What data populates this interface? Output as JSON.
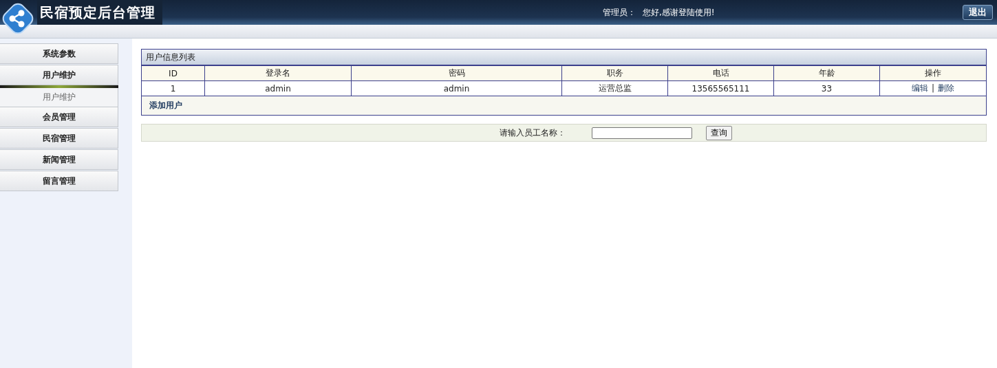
{
  "header": {
    "title": "民宿预定后台管理",
    "greeting_label": "管理员：",
    "greeting": "您好,感谢登陆使用!",
    "logout": "退出"
  },
  "sidebar": {
    "items": [
      {
        "label": "系统参数",
        "expanded": false
      },
      {
        "label": "用户维护",
        "expanded": true,
        "children": [
          {
            "label": "用户维护"
          }
        ]
      },
      {
        "label": "会员管理",
        "expanded": false
      },
      {
        "label": "民宿管理",
        "expanded": false
      },
      {
        "label": "新闻管理",
        "expanded": false
      },
      {
        "label": "留言管理",
        "expanded": false
      }
    ]
  },
  "panel": {
    "title": "用户信息列表",
    "table": {
      "columns": [
        "ID",
        "登录名",
        "密码",
        "职务",
        "电话",
        "年龄",
        "操作"
      ],
      "rows": [
        {
          "cells": [
            "1",
            "admin",
            "admin",
            "运营总监",
            "13565565111",
            "33"
          ],
          "actions": [
            "编辑",
            "删除"
          ],
          "separator": "|"
        }
      ]
    },
    "add_link": "添加用户"
  },
  "search": {
    "label": "请输入员工名称：",
    "button": "查询"
  }
}
